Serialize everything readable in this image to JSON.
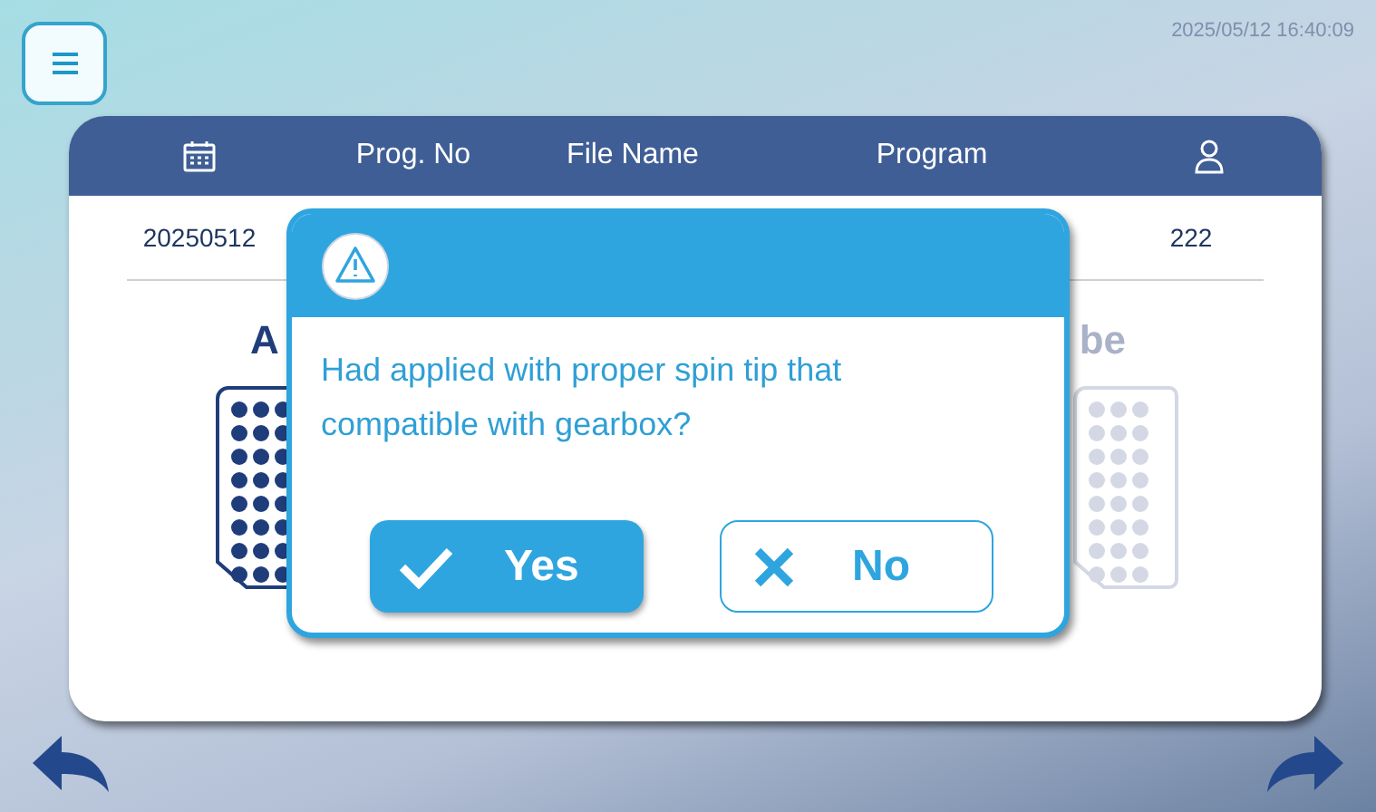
{
  "clock": "2025/05/12  16:40:09",
  "table": {
    "columns": [
      {
        "kind": "date-icon"
      },
      {
        "kind": "text",
        "label": "Prog. No"
      },
      {
        "kind": "text",
        "label": "File Name"
      },
      {
        "kind": "text",
        "label": "Program"
      },
      {
        "kind": "user-icon"
      }
    ],
    "rows": [
      {
        "date": "20250512",
        "user": "222"
      }
    ]
  },
  "left_label": "A",
  "right_label": "be",
  "dialog": {
    "message": "Had applied with proper spin tip that compatible with gearbox?",
    "buttons": [
      {
        "kind": "yes",
        "label": "Yes"
      },
      {
        "kind": "no",
        "label": "No"
      }
    ]
  }
}
